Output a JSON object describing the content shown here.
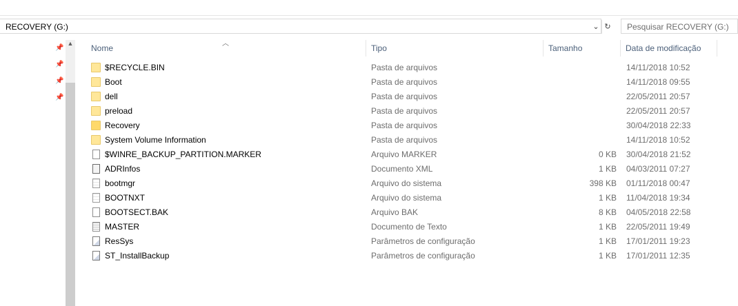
{
  "address": {
    "path": "RECOVERY (G:)",
    "dropdown_icon": "chevron-down-icon",
    "refresh_icon": "refresh-icon"
  },
  "search": {
    "placeholder": "Pesquisar RECOVERY (G:)"
  },
  "columns": {
    "name": "Nome",
    "type": "Tipo",
    "size": "Tamanho",
    "date": "Data de modificação"
  },
  "rows": [
    {
      "name": "$RECYCLE.BIN",
      "type": "Pasta de arquivos",
      "size": "",
      "date": "14/11/2018 10:52",
      "icon": "folder-icon"
    },
    {
      "name": "Boot",
      "type": "Pasta de arquivos",
      "size": "",
      "date": "14/11/2018 09:55",
      "icon": "folder-icon"
    },
    {
      "name": "dell",
      "type": "Pasta de arquivos",
      "size": "",
      "date": "22/05/2011 20:57",
      "icon": "folder-icon"
    },
    {
      "name": "preload",
      "type": "Pasta de arquivos",
      "size": "",
      "date": "22/05/2011 20:57",
      "icon": "folder-icon"
    },
    {
      "name": "Recovery",
      "type": "Pasta de arquivos",
      "size": "",
      "date": "30/04/2018 22:33",
      "icon": "folder-icon"
    },
    {
      "name": "System Volume Information",
      "type": "Pasta de arquivos",
      "size": "",
      "date": "14/11/2018 10:52",
      "icon": "folder-icon"
    },
    {
      "name": "$WINRE_BACKUP_PARTITION.MARKER",
      "type": "Arquivo MARKER",
      "size": "0 KB",
      "date": "30/04/2018 21:52",
      "icon": "file-icon"
    },
    {
      "name": "ADRInfos",
      "type": "Documento XML",
      "size": "1 KB",
      "date": "04/03/2011 07:27",
      "icon": "xml-file-icon"
    },
    {
      "name": "bootmgr",
      "type": "Arquivo do sistema",
      "size": "398 KB",
      "date": "01/11/2018 00:47",
      "icon": "system-file-icon"
    },
    {
      "name": "BOOTNXT",
      "type": "Arquivo do sistema",
      "size": "1 KB",
      "date": "11/04/2018 19:34",
      "icon": "system-file-icon"
    },
    {
      "name": "BOOTSECT.BAK",
      "type": "Arquivo BAK",
      "size": "8 KB",
      "date": "04/05/2018 22:58",
      "icon": "file-icon"
    },
    {
      "name": "MASTER",
      "type": "Documento de Texto",
      "size": "1 KB",
      "date": "22/05/2011 19:49",
      "icon": "text-file-icon"
    },
    {
      "name": "ResSys",
      "type": "Parâmetros de configuração",
      "size": "1 KB",
      "date": "17/01/2011 19:23",
      "icon": "config-file-icon"
    },
    {
      "name": "ST_InstallBackup",
      "type": "Parâmetros de configuração",
      "size": "1 KB",
      "date": "17/01/2011 12:35",
      "icon": "config-file-icon"
    }
  ]
}
